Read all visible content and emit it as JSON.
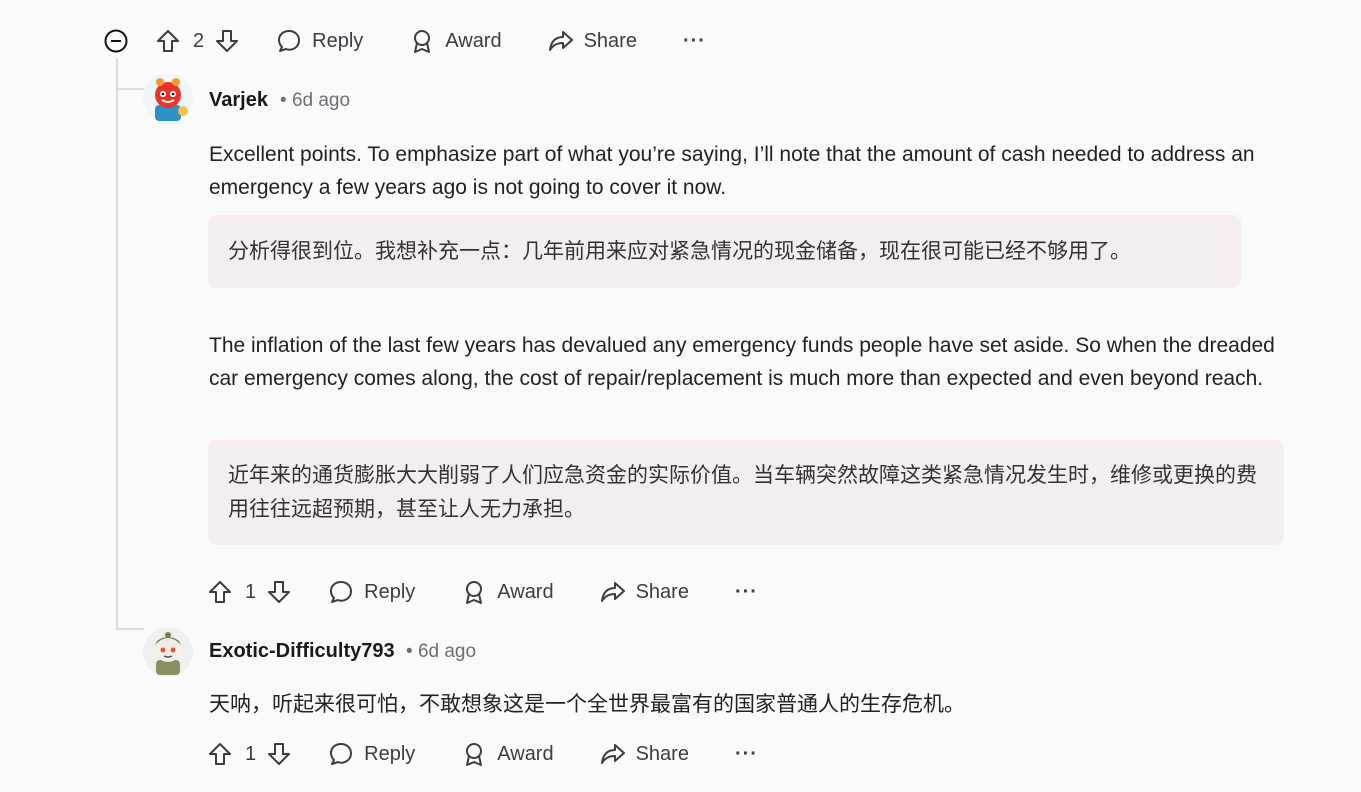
{
  "top_actions": {
    "vote_count": "2",
    "reply": "Reply",
    "award": "Award",
    "share": "Share",
    "more": "···"
  },
  "comments": [
    {
      "author": "Varjek",
      "time": "6d ago",
      "paragraphs": [
        "Excellent points. To emphasize part of what you’re saying, I’ll note that the amount of cash needed to address an emergency a few years ago is not going to cover it now.",
        "The inflation of the last few years has devalued any emergency funds people have set aside. So when the dreaded car emergency comes along, the cost of repair/replacement is much more than expected and even beyond reach."
      ],
      "translations": [
        "分析得很到位。我想补充一点：几年前用来应对紧急情况的现金储备，现在很可能已经不够用了。",
        "近年来的通货膨胀大大削弱了人们应急资金的实际价值。当车辆突然故障这类紧急情况发生时，维修或更换的费用往往远超预期，甚至让人无力承担。"
      ],
      "actions": {
        "vote_count": "1",
        "reply": "Reply",
        "award": "Award",
        "share": "Share",
        "more": "···"
      }
    },
    {
      "author": "Exotic-Difficulty793",
      "time": "6d ago",
      "body": "天呐，听起来很可怕，不敢想象这是一个全世界最富有的国家普通人的生存危机。",
      "actions": {
        "vote_count": "1",
        "reply": "Reply",
        "award": "Award",
        "share": "Share",
        "more": "···"
      }
    }
  ],
  "colors": {
    "text": "#1a1a1b",
    "muted": "#6b6f75",
    "translation_bg": "#f4eeee",
    "thread_line": "#dcdcdc"
  }
}
